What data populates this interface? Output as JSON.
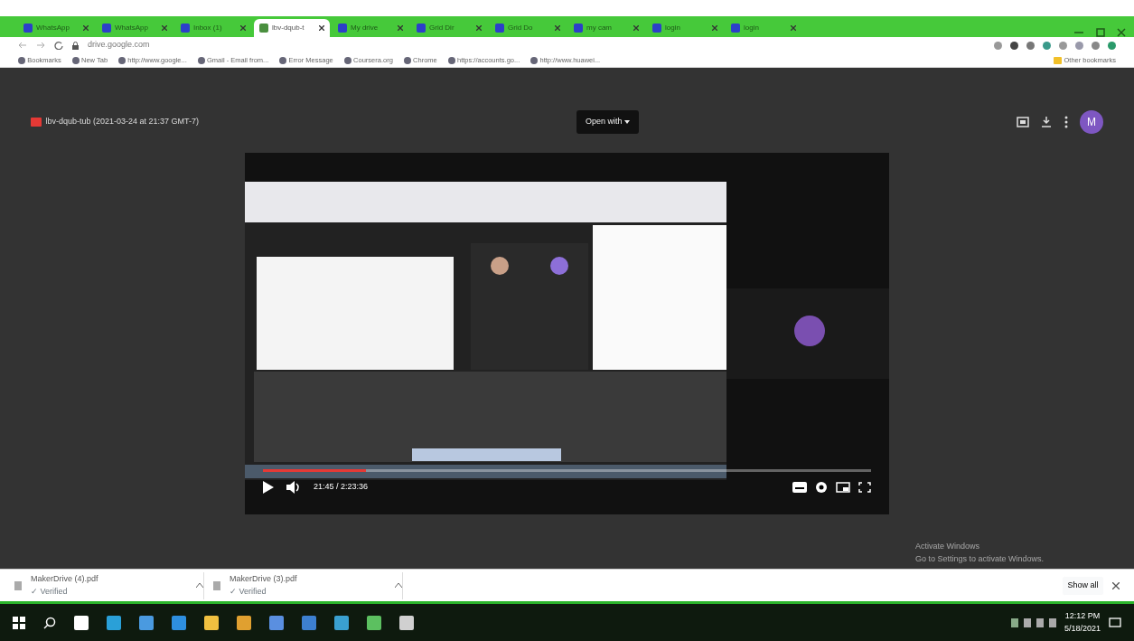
{
  "tabs": [
    {
      "title": "WhatsApp",
      "selected": false
    },
    {
      "title": "WhatsApp",
      "selected": false
    },
    {
      "title": "Inbox (1)",
      "selected": false
    },
    {
      "title": "lbv-dqub-t",
      "selected": true
    },
    {
      "title": "My drive",
      "selected": false
    },
    {
      "title": "Grid Dir",
      "selected": false
    },
    {
      "title": "Grid Do",
      "selected": false
    },
    {
      "title": "my cam",
      "selected": false
    },
    {
      "title": "login",
      "selected": false
    },
    {
      "title": "login",
      "selected": false
    }
  ],
  "address": "drive.google.com",
  "bookmarks": [
    "Bookmarks",
    "New Tab",
    "http://www.google...",
    "Gmail - Email from...",
    "Error Message",
    "Coursera.org",
    "Chrome",
    "https://accounts.go...",
    "http://www.huawei..."
  ],
  "other_bookmarks": "Other bookmarks",
  "viewer": {
    "file_title": "lbv-dqub-tub (2021-03-24 at 21:37 GMT-7)",
    "open_with": "Open with",
    "avatar": "M",
    "player": {
      "level": 0.17,
      "time": "21:45 / 2:23:36"
    }
  },
  "downloads": [
    {
      "name": "MakerDrive (4).pdf",
      "status": "✓ Verified"
    },
    {
      "name": "MakerDrive (3).pdf",
      "status": "✓ Verified"
    }
  ],
  "show_all": "Show all",
  "system_notice": {
    "title": "Activate Windows",
    "text": "Go to Settings to activate Windows."
  },
  "taskbar": {
    "time": "12:12 PM",
    "date": "5/18/2021"
  }
}
